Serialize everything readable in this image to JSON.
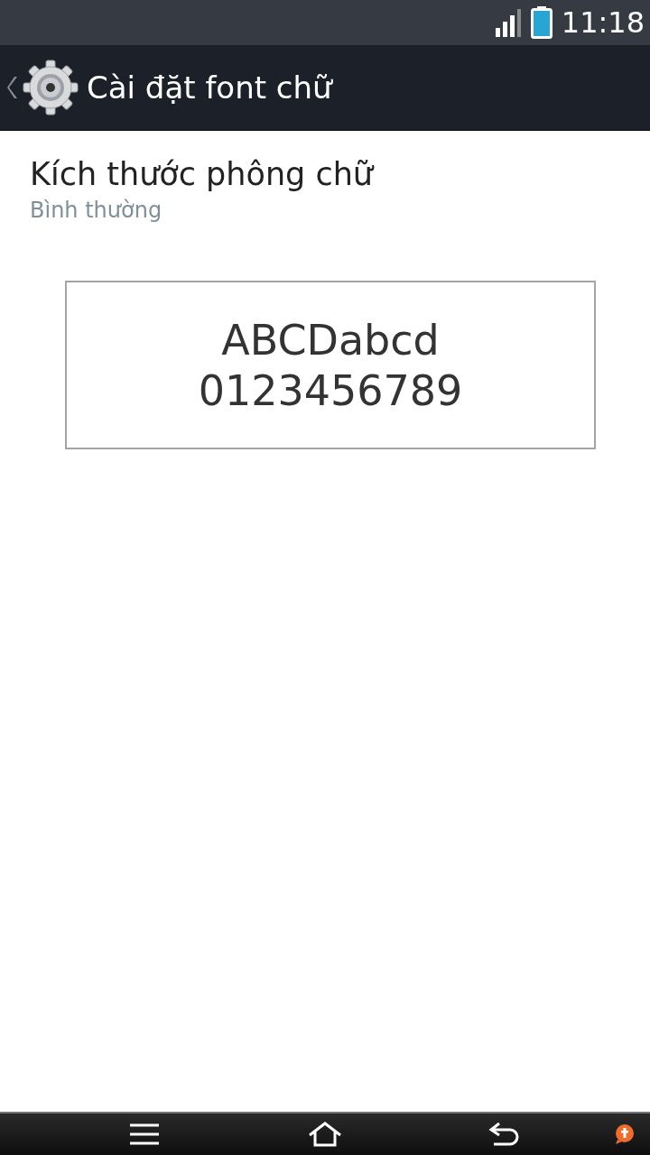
{
  "status_bar": {
    "time": "11:18"
  },
  "action_bar": {
    "title": "Cài đặt font chữ"
  },
  "setting": {
    "title": "Kích thước phông chữ",
    "summary": "Bình thường"
  },
  "preview": {
    "lines": [
      "ABCDabcd",
      "0123456789"
    ]
  }
}
